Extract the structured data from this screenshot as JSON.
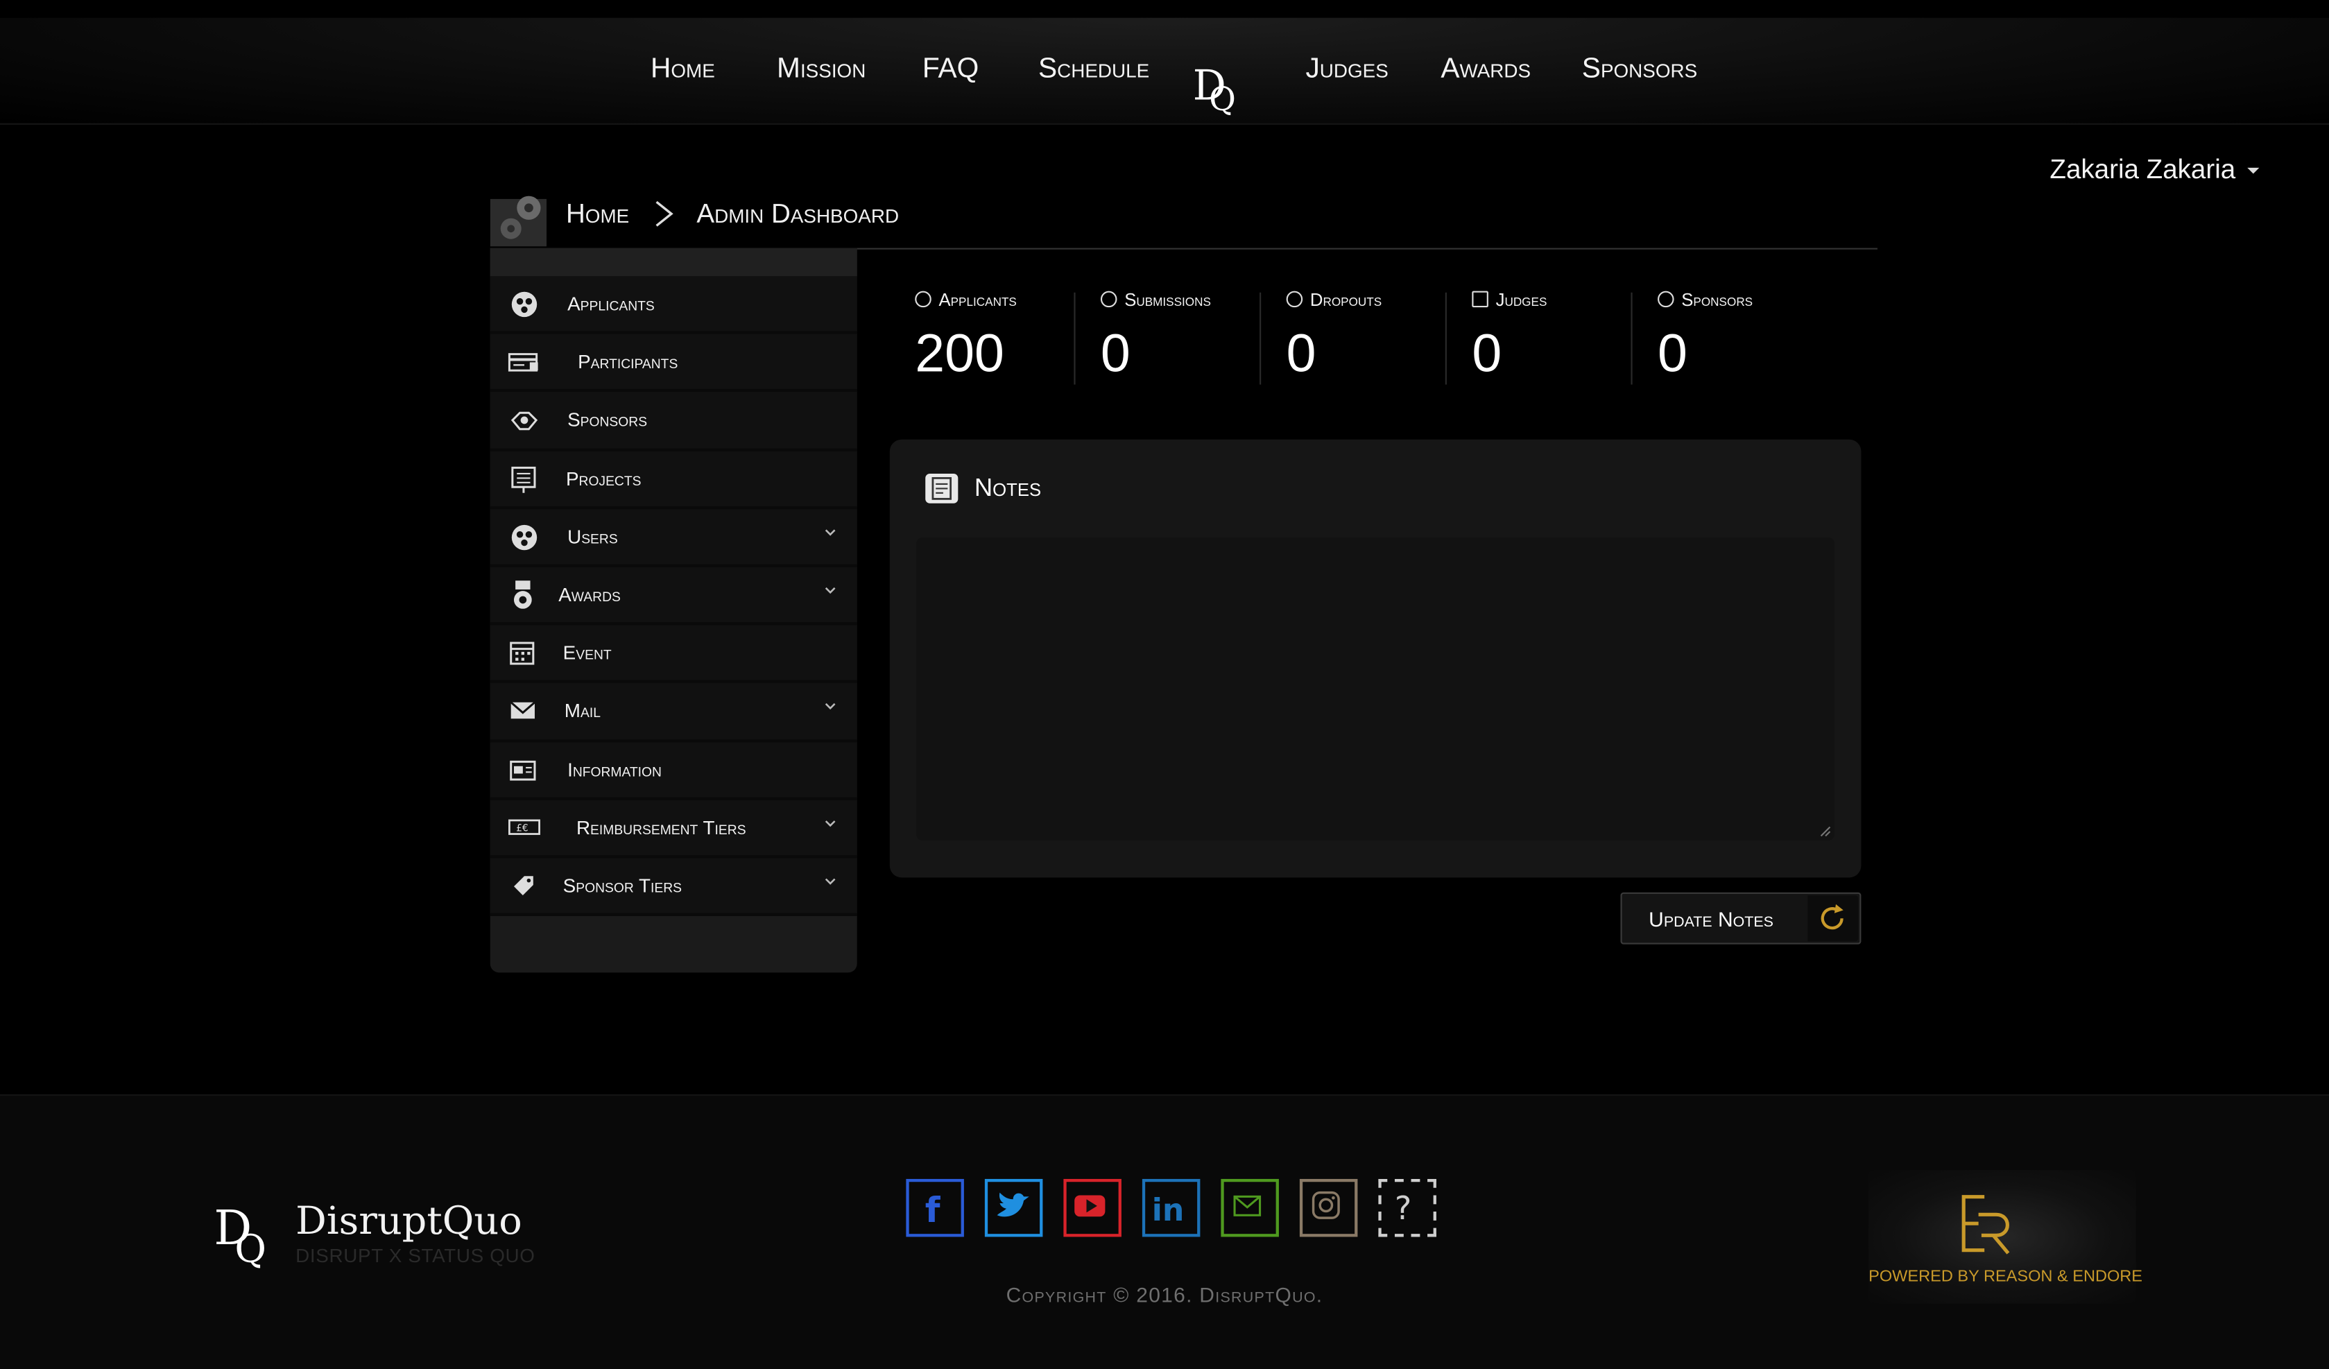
{
  "nav": {
    "items": [
      "Home",
      "Mission",
      "FAQ",
      "Schedule",
      "Judges",
      "Awards",
      "Sponsors"
    ],
    "logo_text": "DQ"
  },
  "user": {
    "name": "Zakaria Zakaria"
  },
  "breadcrumb": {
    "home": "Home",
    "current": "Admin Dashboard"
  },
  "sidebar": {
    "items": [
      {
        "label": "Applicants",
        "icon": "applicants-icon",
        "has_submenu": false
      },
      {
        "label": "Participants",
        "icon": "id-card-icon",
        "has_submenu": false
      },
      {
        "label": "Sponsors",
        "icon": "handshake-icon",
        "has_submenu": false
      },
      {
        "label": "Projects",
        "icon": "presentation-icon",
        "has_submenu": false
      },
      {
        "label": "Users",
        "icon": "users-icon",
        "has_submenu": true
      },
      {
        "label": "Awards",
        "icon": "medal-icon",
        "has_submenu": true
      },
      {
        "label": "Event",
        "icon": "calendar-icon",
        "has_submenu": false
      },
      {
        "label": "Mail",
        "icon": "envelope-icon",
        "has_submenu": true
      },
      {
        "label": "Information",
        "icon": "newspaper-icon",
        "has_submenu": false
      },
      {
        "label": "Reimbursement Tiers",
        "icon": "ticket-icon",
        "has_submenu": true
      },
      {
        "label": "Sponsor Tiers",
        "icon": "tag-icon",
        "has_submenu": true
      }
    ]
  },
  "stats": [
    {
      "label": "Applicants",
      "value": "200"
    },
    {
      "label": "Submissions",
      "value": "0"
    },
    {
      "label": "Dropouts",
      "value": "0"
    },
    {
      "label": "Judges",
      "value": "0"
    },
    {
      "label": "Sponsors",
      "value": "0"
    }
  ],
  "notes": {
    "title": "Notes",
    "value": "",
    "button_label": "Update Notes"
  },
  "footer": {
    "brand": "DisruptQuo",
    "tagline": "DISRUPT X STATUS QUO",
    "social": [
      {
        "name": "facebook-icon",
        "color": "#2a5bd7"
      },
      {
        "name": "twitter-icon",
        "color": "#1f8fe0"
      },
      {
        "name": "youtube-icon",
        "color": "#d8232a"
      },
      {
        "name": "linkedin-icon",
        "color": "#1c72b8"
      },
      {
        "name": "mail-icon",
        "color": "#4f9a1f"
      },
      {
        "name": "instagram-icon",
        "color": "#8a7a66"
      },
      {
        "name": "help-icon",
        "color": "#cfcfcf"
      }
    ],
    "copyright": "Copyright © 2016. DisruptQuo.",
    "powered_by": "POWERED BY REASON & ENDORE"
  },
  "colors": {
    "accent_gold": "#c99a2a",
    "background": "#000000",
    "panel": "#161616"
  }
}
